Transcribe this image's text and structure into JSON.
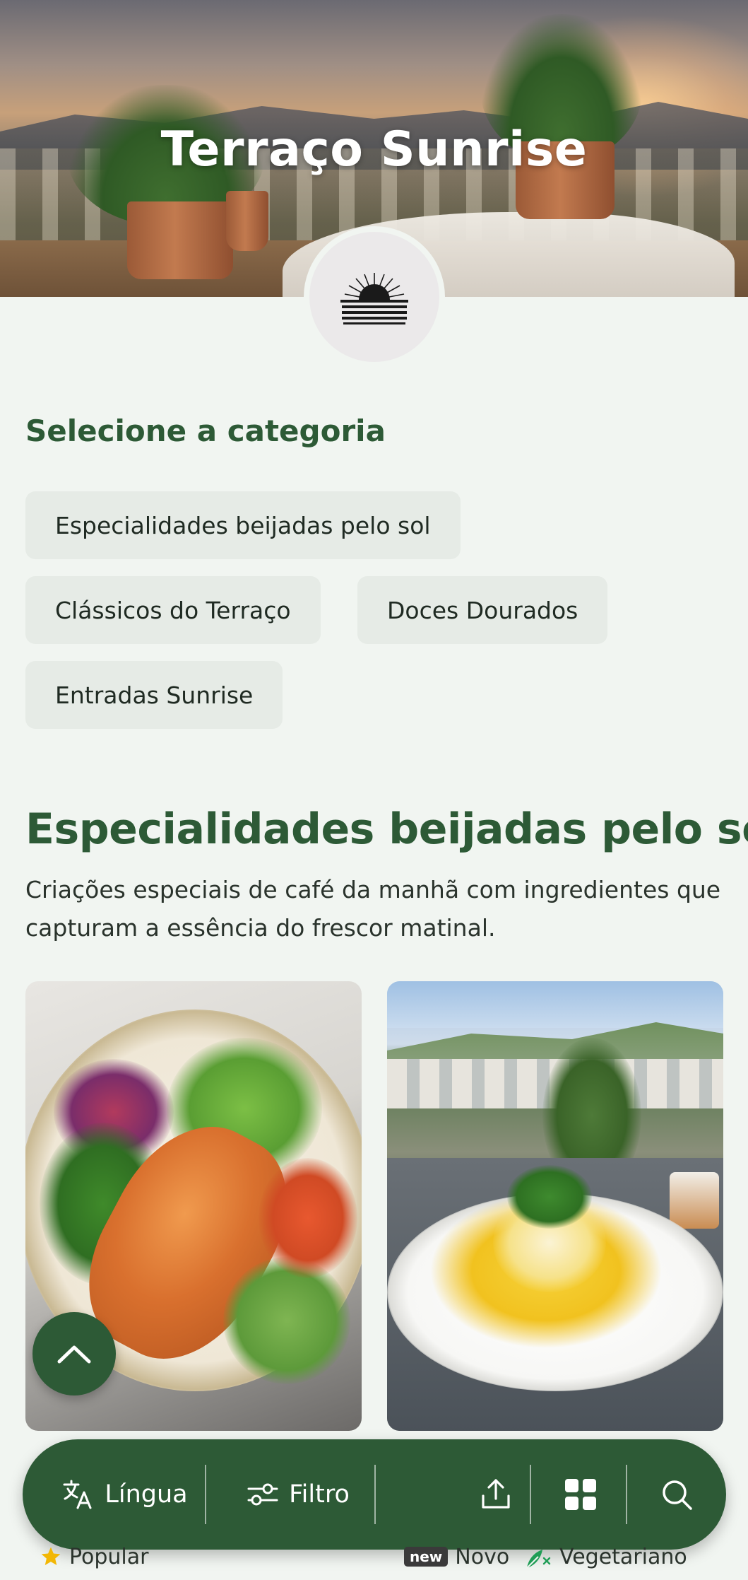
{
  "hero": {
    "title": "Terraço Sunrise",
    "logo_icon": "sunrise-logo-icon"
  },
  "categories": {
    "heading": "Selecione a categoria",
    "items": [
      {
        "label": "Especialidades beijadas pelo sol"
      },
      {
        "label": "Clássicos do Terraço"
      },
      {
        "label": "Doces Dourados"
      },
      {
        "label": "Entradas Sunrise"
      }
    ]
  },
  "section": {
    "title": "Especialidades beijadas pelo sol",
    "description": "Criações especiais de café da manhã com ingredientes que capturam a essência do frescor matinal.",
    "cards": [
      {
        "image": "salmon-bowl-photo"
      },
      {
        "image": "eggs-benedict-terrace-photo"
      }
    ]
  },
  "fab": {
    "icon": "chevron-up-icon"
  },
  "bottom_nav": {
    "language_label": "Língua",
    "filter_label": "Filtro",
    "icons": [
      "translate-icon",
      "sliders-icon",
      "share-icon",
      "grid-icon",
      "search-icon"
    ]
  },
  "legend": {
    "popular": "Popular",
    "new_badge": "new",
    "new_label": "Novo",
    "vegetarian": "Vegetariano"
  },
  "colors": {
    "brand_green": "#2d5a36",
    "background": "#f1f5f1",
    "chip_bg": "#e6ebe6",
    "star": "#f2b705",
    "veg_green": "#1f9d55"
  }
}
